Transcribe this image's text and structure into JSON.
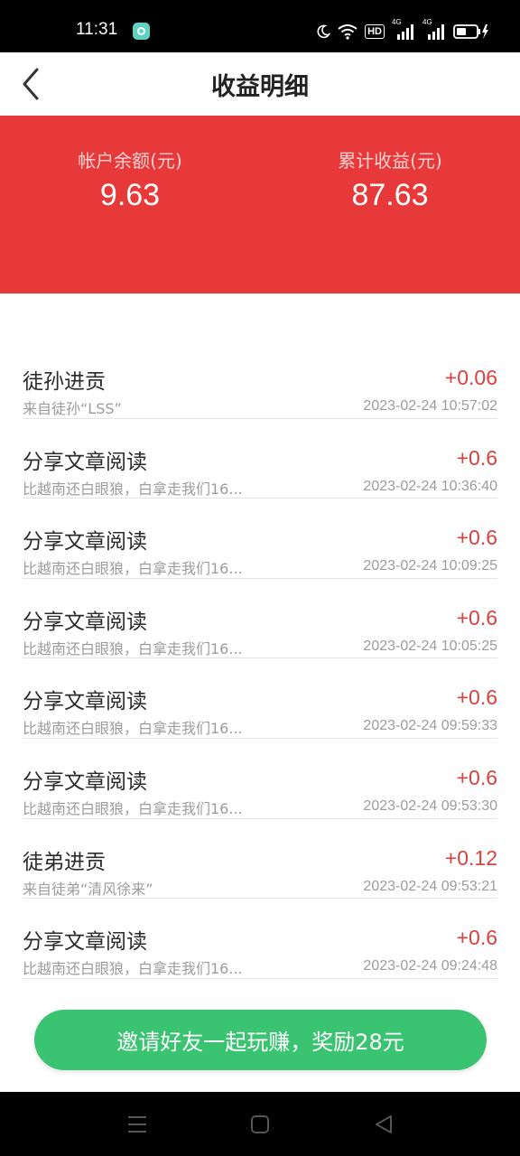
{
  "status_bar": {
    "time": "11:31",
    "hd_label": "HD",
    "sig1_label": "4G",
    "sig2_label": "4G"
  },
  "header": {
    "title": "收益明细",
    "back_icon": "chevron-left-icon"
  },
  "summary": {
    "balance_label": "帐户余额(元)",
    "balance_value": "9.63",
    "total_label": "累计收益(元)",
    "total_value": "87.63"
  },
  "transactions": [
    {
      "title": "徒孙进贡",
      "subtitle": "来自徒孙“LSS”",
      "amount": "+0.06",
      "time": "2023-02-24 10:57:02"
    },
    {
      "title": "分享文章阅读",
      "subtitle": "比越南还白眼狼，白拿走我们16...",
      "amount": "+0.6",
      "time": "2023-02-24 10:36:40"
    },
    {
      "title": "分享文章阅读",
      "subtitle": "比越南还白眼狼，白拿走我们16...",
      "amount": "+0.6",
      "time": "2023-02-24 10:09:25"
    },
    {
      "title": "分享文章阅读",
      "subtitle": "比越南还白眼狼，白拿走我们16...",
      "amount": "+0.6",
      "time": "2023-02-24 10:05:25"
    },
    {
      "title": "分享文章阅读",
      "subtitle": "比越南还白眼狼，白拿走我们16...",
      "amount": "+0.6",
      "time": "2023-02-24 09:59:33"
    },
    {
      "title": "分享文章阅读",
      "subtitle": "比越南还白眼狼，白拿走我们16...",
      "amount": "+0.6",
      "time": "2023-02-24 09:53:30"
    },
    {
      "title": "徒弟进贡",
      "subtitle": "来自徒弟“清风徐来”",
      "amount": "+0.12",
      "time": "2023-02-24 09:53:21"
    },
    {
      "title": "分享文章阅读",
      "subtitle": "比越南还白眼狼，白拿走我们16...",
      "amount": "+0.6",
      "time": "2023-02-24 09:24:48"
    }
  ],
  "invite": {
    "label": "邀请好友一起玩赚，奖励28元"
  },
  "colors": {
    "summary_bg": "#e8393a",
    "amount": "#d7413e",
    "invite_bg": "#3ac471"
  }
}
